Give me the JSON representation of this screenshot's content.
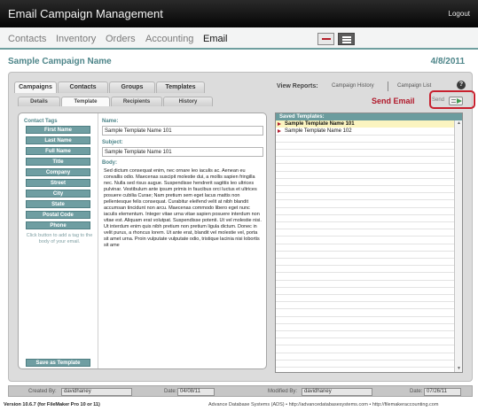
{
  "app": {
    "title": "Email Campaign Management",
    "logout_label": "Logout"
  },
  "nav": {
    "items": [
      "Contacts",
      "Inventory",
      "Orders",
      "Accounting",
      "Email"
    ],
    "active": "Email"
  },
  "header": {
    "campaign_title": "Sample Campaign Name",
    "date": "4/8/2011"
  },
  "tabs": [
    "Campaigns",
    "Contacts",
    "Groups",
    "Templates"
  ],
  "subtabs": [
    "Details",
    "Template",
    "Recipients",
    "History"
  ],
  "reports": {
    "label": "View Reports:",
    "links": [
      "Campaign History",
      "Campaign List"
    ]
  },
  "help_label": "?",
  "send": {
    "label": "Send Email",
    "small_label": "Send"
  },
  "tags": {
    "label": "Contact Tags",
    "buttons": [
      "First Name",
      "Last Name",
      "Full Name",
      "Title",
      "Company",
      "Street",
      "City",
      "State",
      "Postal Code",
      "Phone"
    ],
    "hint": "Click button to add a tag to the body of your email.",
    "save_button": "Save as Template"
  },
  "form": {
    "name_label": "Name:",
    "name_value": "Sample Template Name 101",
    "subject_label": "Subject:",
    "subject_value": "Sample Template Name 101",
    "body_label": "Body:",
    "body_value": "Sed dictum consequat enim, nec ornare leo iaculis ac. Aenean eu convallis odio. Maecenas suscipit molestie dui, a mollis sapien fringilla nec. Nulla sed risus augue. Suspendisse hendrerit sagittis leo ultrices pulvinar. Vestibulum ante ipsum primis in faucibus orci luctus et ultrices posuere cubilia Curae; Nam pretium sem eget lacus mattis non pellentesque felis consequat. Curabitur eleifend velit at nibh blandit accumsan tincidunt non arcu. Maecenas commodo libero eget nunc iaculis elementum. Integer vitae urna vitae sapien posuere interdum non vitae est. Aliquam erat volutpat. Suspendisse potenti. Ut vel molestie nisi. Ut interdum enim quis nibh pretium non pretium ligula dictum. Donec in velit purus, a rhoncus lorem. Ut ante erat, blandit vel molestie vel, porta sit amet urna. Proin vulputate vulputate odio, tristique lacinia nisi lobortis sit ame"
  },
  "saved_templates": {
    "header": "Saved Templates:",
    "items": [
      "Sample Template Name 101",
      "Sample Template Name 102"
    ],
    "selected_index": 0
  },
  "footer": {
    "created_by_label": "Created By:",
    "created_by": "davidhaney",
    "created_date_label": "Date:",
    "created_date": "04/08/11",
    "modified_by_label": "Modified By:",
    "modified_by": "davidhaney",
    "modified_date_label": "Date:",
    "modified_date": "07/26/11"
  },
  "bottom": {
    "version": "Version 10.6.7 (for FileMaker Pro 10 or 11)",
    "credits": "Advance Database Systems (ADS) • http://advancedatabasesystems.com • http://filemakeraccounting.com"
  },
  "colors": {
    "accent_teal": "#6f9ea2",
    "highlight_red": "#c8202e",
    "selected_row": "#fbf4c0"
  }
}
